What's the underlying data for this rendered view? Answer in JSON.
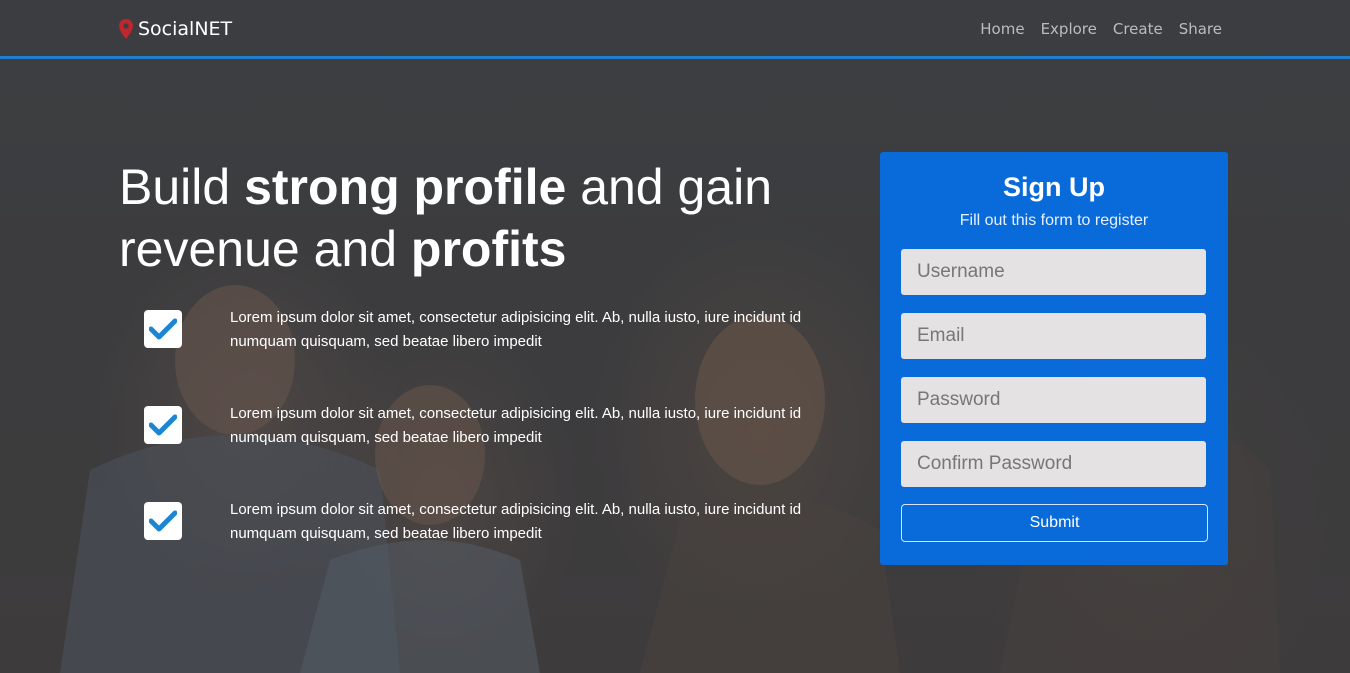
{
  "navbar": {
    "brand": "SocialNET",
    "brand_icon": "map-marker-icon",
    "links": [
      "Home",
      "Explore",
      "Create",
      "Share"
    ]
  },
  "hero": {
    "title_parts": [
      "Build ",
      "strong profile",
      " and gain revenue and ",
      "profits"
    ]
  },
  "features": [
    {
      "icon": "check-icon",
      "text": "Lorem ipsum dolor sit amet, consectetur adipisicing elit. Ab, nulla iusto, iure incidunt id numquam quisquam, sed beatae libero impedit"
    },
    {
      "icon": "check-icon",
      "text": "Lorem ipsum dolor sit amet, consectetur adipisicing elit. Ab, nulla iusto, iure incidunt id numquam quisquam, sed beatae libero impedit"
    },
    {
      "icon": "check-icon",
      "text": "Lorem ipsum dolor sit amet, consectetur adipisicing elit. Ab, nulla iusto, iure incidunt id numquam quisquam, sed beatae libero impedit"
    }
  ],
  "signup": {
    "title": "Sign Up",
    "subtitle": "Fill out this form to register",
    "username_placeholder": "Username",
    "email_placeholder": "Email",
    "password_placeholder": "Password",
    "confirm_placeholder": "Confirm Password",
    "submit_label": "Submit"
  },
  "colors": {
    "accent": "#1f7fce",
    "card": "#056ee6",
    "check": "#1a86d4",
    "brand_icon": "#c0262d"
  }
}
